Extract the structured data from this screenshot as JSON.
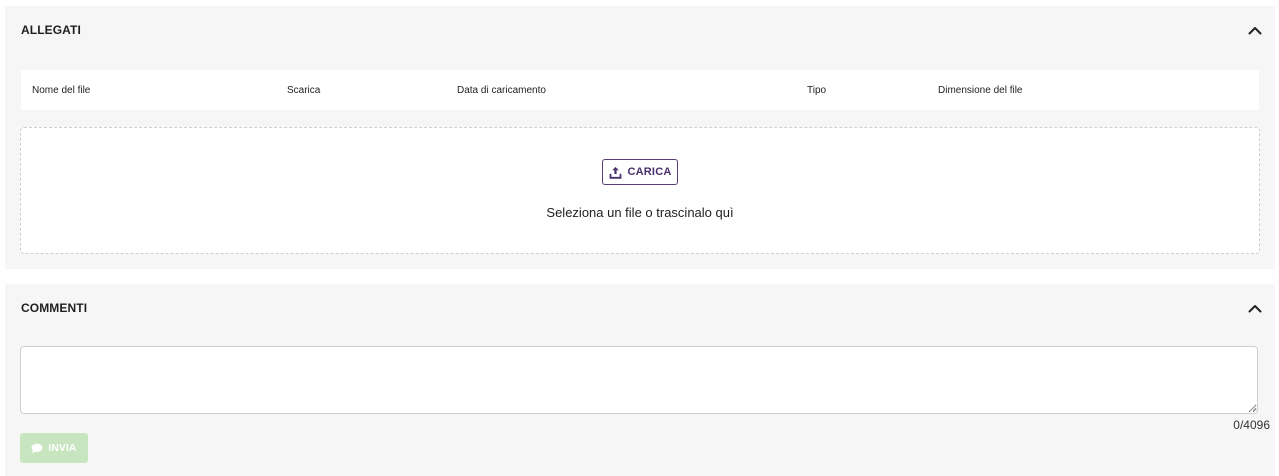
{
  "attachments": {
    "title": "ALLEGATI",
    "columns": {
      "name": "Nome del file",
      "download": "Scarica",
      "upload_date": "Data di caricamento",
      "type": "Tipo",
      "size": "Dimensione del file"
    },
    "upload_button_label": "CARICA",
    "drop_hint": "Seleziona un file o trascinalo quì",
    "icons": {
      "collapse": "chevron-up-icon",
      "upload": "upload-icon"
    }
  },
  "comments": {
    "title": "COMMENTI",
    "textarea_value": "",
    "char_counter": "0/4096",
    "send_button_label": "INVIA",
    "send_button_enabled": false,
    "icons": {
      "collapse": "chevron-up-icon",
      "send": "speech-bubble-icon"
    }
  },
  "colors": {
    "panel_bg": "#f6f6f6",
    "upload_accent": "#4a2f6b",
    "send_disabled_bg": "#c7e6bf"
  }
}
